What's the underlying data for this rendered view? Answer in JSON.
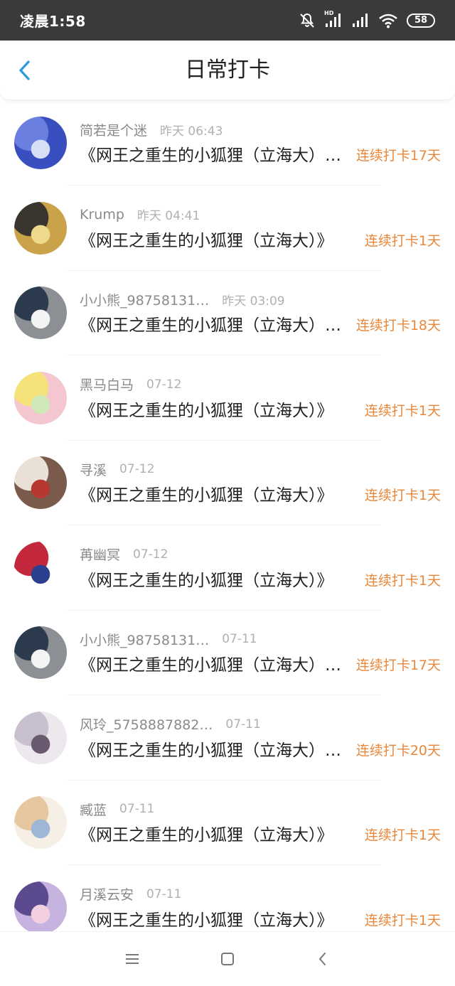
{
  "status_bar": {
    "time": "凌晨1:58",
    "battery": "58",
    "signal_label": "HD",
    "icons": [
      "mute-bell-icon",
      "hd-signal-icon",
      "signal-icon",
      "wifi-icon",
      "battery-icon"
    ]
  },
  "header": {
    "title": "日常打卡",
    "back_icon": "chevron-left-icon",
    "accent_color": "#2a9bd8"
  },
  "streak_color": "#e8873a",
  "checkins": [
    {
      "name": "简若是个迷",
      "time": "昨天 06:43",
      "book": "《网王之重生的小狐狸（立海大）…",
      "streak": "连续打卡17天",
      "avatar_colors": [
        "#3a4fbf",
        "#6a7fe0",
        "#d7dff5"
      ]
    },
    {
      "name": "Krump",
      "time": "昨天 04:41",
      "book": "《网王之重生的小狐狸（立海大）》",
      "streak": "连续打卡1天",
      "avatar_colors": [
        "#c9a24a",
        "#3b3530",
        "#efd98c"
      ]
    },
    {
      "name": "小小熊_98758131…",
      "time": "昨天 03:09",
      "book": "《网王之重生的小狐狸（立海大）…",
      "streak": "连续打卡18天",
      "avatar_colors": [
        "#8c8f94",
        "#2c3a4e",
        "#f4f4f4"
      ]
    },
    {
      "name": "黑马白马",
      "time": "07-12",
      "book": "《网王之重生的小狐狸（立海大）》",
      "streak": "连续打卡1天",
      "avatar_colors": [
        "#f4c6cf",
        "#f6e27a",
        "#cfe8b8"
      ]
    },
    {
      "name": "寻溪",
      "time": "07-12",
      "book": "《网王之重生的小狐狸（立海大）》",
      "streak": "连续打卡1天",
      "avatar_colors": [
        "#7a5a4a",
        "#e9e1d6",
        "#b5392f"
      ]
    },
    {
      "name": "苒幽冥",
      "time": "07-12",
      "book": "《网王之重生的小狐狸（立海大）》",
      "streak": "连续打卡1天",
      "avatar_colors": [
        "#ffffff",
        "#c4283c",
        "#2b3f8e"
      ]
    },
    {
      "name": "小小熊_98758131…",
      "time": "07-11",
      "book": "《网王之重生的小狐狸（立海大）…",
      "streak": "连续打卡17天",
      "avatar_colors": [
        "#8c8f94",
        "#2c3a4e",
        "#f4f4f4"
      ]
    },
    {
      "name": "风玲_5758887882…",
      "time": "07-11",
      "book": "《网王之重生的小狐狸（立海大）…",
      "streak": "连续打卡20天",
      "avatar_colors": [
        "#ece8ee",
        "#c9c0cf",
        "#6a5a70"
      ]
    },
    {
      "name": "臧蓝",
      "time": "07-11",
      "book": "《网王之重生的小狐狸（立海大）》",
      "streak": "连续打卡1天",
      "avatar_colors": [
        "#f5efe6",
        "#e6c7a0",
        "#9fb6d6"
      ]
    },
    {
      "name": "月溪云安",
      "time": "07-11",
      "book": "《网王之重生的小狐狸（立海大）》",
      "streak": "连续打卡1天",
      "avatar_colors": [
        "#c7b3e0",
        "#5b4a8e",
        "#f2d0e0"
      ]
    }
  ],
  "nav_bar": {
    "icons": [
      "menu-icon",
      "home-square-icon",
      "back-triangle-icon"
    ]
  }
}
